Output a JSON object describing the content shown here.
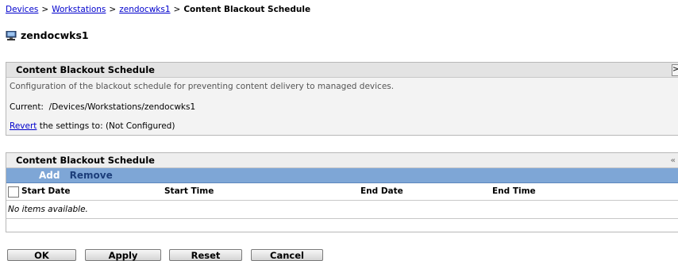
{
  "breadcrumb": {
    "items": [
      "Devices",
      "Workstations",
      "zendocwks1"
    ],
    "separator": ">",
    "current": "Content Blackout Schedule"
  },
  "device": {
    "name": "zendocwks1",
    "icon": "workstation-icon"
  },
  "settings_panel": {
    "title": "Content Blackout Schedule",
    "corner_glyph": ">",
    "description": "Configuration of the blackout schedule for preventing content delivery to managed devices.",
    "current_label": "Current:",
    "current_path": "/Devices/Workstations/zendocwks1",
    "revert_link": "Revert",
    "revert_text": "the settings to: (Not Configured)"
  },
  "schedule_table": {
    "title": "Content Blackout Schedule",
    "collapse_glyph": "«",
    "add_label": "Add",
    "remove_label": "Remove",
    "columns": [
      "Start Date",
      "Start Time",
      "End Date",
      "End Time"
    ],
    "empty_text": "No items available."
  },
  "buttons": {
    "ok": "OK",
    "apply": "Apply",
    "reset": "Reset",
    "cancel": "Cancel"
  },
  "colors": {
    "toolbar": "#7ea6d6",
    "link": "#0000cc",
    "header": "#e3e3e3"
  }
}
